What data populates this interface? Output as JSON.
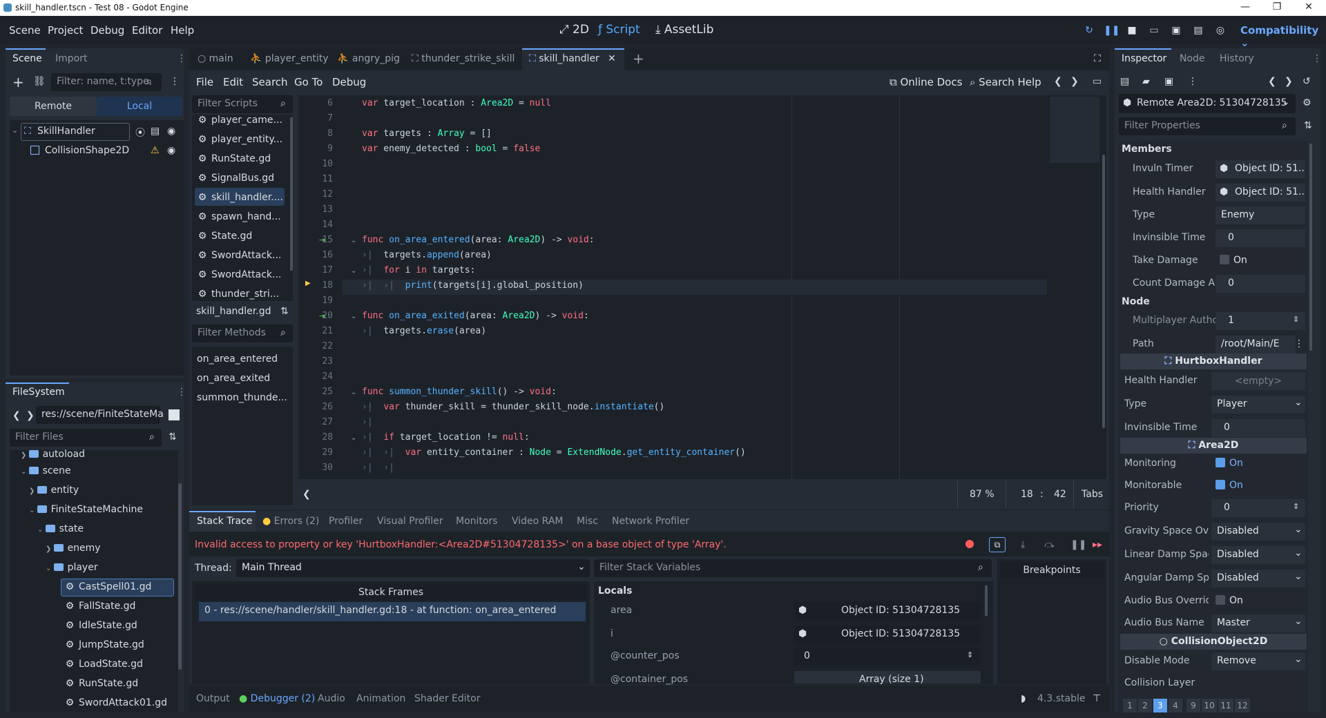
{
  "window": {
    "title": "skill_handler.tscn - Test 08 - Godot Engine"
  },
  "menubar": {
    "menus": [
      "Scene",
      "Project",
      "Debug",
      "Editor",
      "Help"
    ],
    "workspaces": [
      "2D",
      "Script",
      "AssetLib"
    ],
    "renderer": "Compatibility"
  },
  "scene_dock": {
    "tabs": [
      "Scene",
      "Import"
    ],
    "filter_placeholder": "Filter: name, t:type,",
    "remote_label": "Remote",
    "local_label": "Local",
    "nodes": [
      "SkillHandler",
      "CollisionShape2D"
    ]
  },
  "filesystem": {
    "tab": "FileSystem",
    "path": "res://scene/FiniteStateMa",
    "filter_placeholder": "Filter Files",
    "items": [
      "autoload",
      "scene",
      "entity",
      "FiniteStateMachine",
      "state",
      "enemy",
      "player",
      "CastSpell01.gd",
      "FallState.gd",
      "IdleState.gd",
      "JumpState.gd",
      "LoadState.gd",
      "RunState.gd",
      "SwordAttack01.gd"
    ]
  },
  "script_tabs": [
    "main",
    "player_entity",
    "angry_pig",
    "thunder_strike_skill",
    "skill_handler"
  ],
  "script_menu": [
    "File",
    "Edit",
    "Search",
    "Go To",
    "Debug"
  ],
  "script_toolbar": {
    "online_docs": "Online Docs",
    "search_help": "Search Help"
  },
  "script_list": {
    "filter_placeholder": "Filter Scripts",
    "items": [
      "player_came...",
      "player_entity...",
      "RunState.gd",
      "SignalBus.gd",
      "skill_handler....",
      "spawn_hand...",
      "State.gd",
      "SwordAttack...",
      "SwordAttack...",
      "thunder_stri..."
    ],
    "current": "skill_handler.gd",
    "methods_placeholder": "Filter Methods",
    "methods": [
      "on_area_entered",
      "on_area_exited",
      "summon_thunde..."
    ]
  },
  "code": {
    "line_numbers": [
      "6",
      "7",
      "8",
      "9",
      "10",
      "11",
      "12",
      "13",
      "14",
      "15",
      "16",
      "17",
      "18",
      "19",
      "20",
      "21",
      "22",
      "23",
      "24",
      "25",
      "26",
      "27",
      "28",
      "29",
      "30"
    ],
    "status": {
      "zoom": "87 %",
      "line": "18",
      "col": "42",
      "indent": "Tabs"
    }
  },
  "debugger": {
    "tabs": [
      "Stack Trace",
      "Errors (2)",
      "Profiler",
      "Visual Profiler",
      "Monitors",
      "Video RAM",
      "Misc",
      "Network Profiler"
    ],
    "error": "Invalid access to property or key 'HurtboxHandler:<Area2D#51304728135>' on a base object of type 'Array'.",
    "thread_label": "Thread:",
    "thread": "Main Thread",
    "stack_frames_title": "Stack Frames",
    "frame": "0 - res://scene/handler/skill_handler.gd:18 - at function: on_area_entered",
    "filter_vars_placeholder": "Filter Stack Variables",
    "locals_title": "Locals",
    "locals": [
      {
        "name": "area",
        "value": "Object ID: 51304728135"
      },
      {
        "name": "i",
        "value": "Object ID: 51304728135"
      },
      {
        "name": "@counter_pos",
        "value": "0"
      },
      {
        "name": "@container_pos",
        "value": "Array (size 1)"
      }
    ],
    "breakpoints": "Breakpoints"
  },
  "bottom_bar": {
    "tabs": [
      "Output",
      "Debugger (2)",
      "Audio",
      "Animation",
      "Shader Editor"
    ],
    "version": "4.3.stable"
  },
  "inspector": {
    "tabs": [
      "Inspector",
      "Node",
      "History"
    ],
    "object": "Remote Area2D: 51304728135",
    "filter_placeholder": "Filter Properties",
    "members_title": "Members",
    "members": [
      {
        "label": "Invuln Timer",
        "value": "Object ID: 51..."
      },
      {
        "label": "Health Handler",
        "value": "Object ID: 51..."
      },
      {
        "label": "Type",
        "value": "Enemy"
      },
      {
        "label": "Invinsible Time",
        "value": "0"
      },
      {
        "label": "Take Damage",
        "value": "On"
      },
      {
        "label": "Count Damage A",
        "value": "0"
      }
    ],
    "node_title": "Node",
    "node_props": [
      {
        "label": "Multiplayer Autho",
        "value": "1"
      },
      {
        "label": "Path",
        "value": "/root/Main/E"
      }
    ],
    "hurtbox_title": "HurtboxHandler",
    "hurtbox_props": [
      {
        "label": "Health Handler",
        "value": "<empty>"
      },
      {
        "label": "Type",
        "value": "Player"
      },
      {
        "label": "Invinsible Time",
        "value": "0"
      }
    ],
    "area2d_title": "Area2D",
    "area2d_props": [
      {
        "label": "Monitoring",
        "value": "On"
      },
      {
        "label": "Monitorable",
        "value": "On"
      },
      {
        "label": "Priority",
        "value": "0"
      },
      {
        "label": "Gravity Space Ove",
        "value": "Disabled"
      },
      {
        "label": "Linear Damp Spac",
        "value": "Disabled"
      },
      {
        "label": "Angular Damp Spa",
        "value": "Disabled"
      },
      {
        "label": "Audio Bus Overrid",
        "value": "On"
      },
      {
        "label": "Audio Bus Name",
        "value": "Master"
      }
    ],
    "collision_title": "CollisionObject2D",
    "collision_props": [
      {
        "label": "Disable Mode",
        "value": "Remove"
      },
      {
        "label": "Collision Layer",
        "value": ""
      }
    ],
    "layers": [
      "1",
      "2",
      "3",
      "4",
      "9",
      "10",
      "11",
      "12"
    ]
  }
}
